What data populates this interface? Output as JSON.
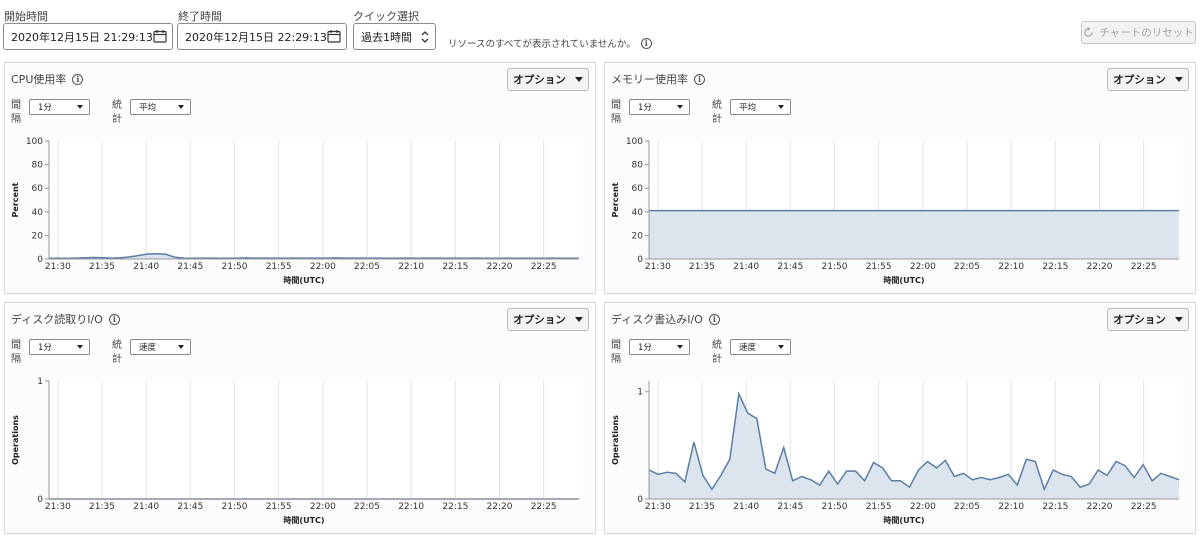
{
  "toolbar": {
    "start_label": "開始時間",
    "start_value": "2020年12月15日 21:29:13",
    "end_label": "終了時間",
    "end_value": "2020年12月15日 22:29:13",
    "quick_label": "クイック選択",
    "quick_value": "過去1時間",
    "hint": "リソースのすべてが表示されていませんか。",
    "reset_label": "チャートのリセット"
  },
  "panels": [
    {
      "title": "CPU使用率",
      "options_label": "オプション",
      "interval_label": "間隔",
      "interval_value": "1分",
      "stat_label": "統計",
      "stat_value": "平均"
    },
    {
      "title": "メモリー使用率",
      "options_label": "オプション",
      "interval_label": "間隔",
      "interval_value": "1分",
      "stat_label": "統計",
      "stat_value": "平均"
    },
    {
      "title": "ディスク読取りI/O",
      "options_label": "オプション",
      "interval_label": "間隔",
      "interval_value": "1分",
      "stat_label": "統計",
      "stat_value": "速度"
    },
    {
      "title": "ディスク書込みI/O",
      "options_label": "オプション",
      "interval_label": "間隔",
      "interval_value": "1分",
      "stat_label": "統計",
      "stat_value": "速度"
    }
  ],
  "chart_data": [
    {
      "type": "area",
      "ylabel": "Percent",
      "xlabel": "時間(UTC)",
      "ylim": [
        0,
        100
      ],
      "yticks": [
        0,
        20,
        40,
        60,
        80,
        100
      ],
      "xticks": [
        "21:30",
        "21:35",
        "21:40",
        "21:45",
        "21:50",
        "21:55",
        "22:00",
        "22:05",
        "22:10",
        "22:15",
        "22:20",
        "22:25"
      ],
      "x_start_min": 29,
      "x_end_min": 89,
      "grid": "vertical",
      "series": [
        {
          "values": [
            0.6,
            0.7,
            0.7,
            0.8,
            1.0,
            1.3,
            1.0,
            0.8,
            1.0,
            1.8,
            3.0,
            4.2,
            4.5,
            4.0,
            1.5,
            0.8,
            0.7,
            0.8,
            0.8,
            0.7,
            0.7,
            0.8,
            0.9,
            0.8,
            0.8,
            0.8,
            0.8,
            0.8,
            0.8,
            0.8,
            0.8,
            0.8,
            0.9,
            0.8,
            0.8,
            0.8,
            0.8,
            0.8,
            0.7,
            0.8,
            0.8,
            0.7,
            0.8,
            0.8,
            0.7,
            0.8,
            0.7,
            0.8,
            0.8,
            0.7,
            0.7,
            0.8,
            0.7,
            0.8,
            0.7,
            0.7,
            0.8,
            0.7,
            0.7,
            0.7
          ]
        }
      ]
    },
    {
      "type": "area",
      "ylabel": "Percent",
      "xlabel": "時間(UTC)",
      "ylim": [
        0,
        100
      ],
      "yticks": [
        0,
        20,
        40,
        60,
        80,
        100
      ],
      "xticks": [
        "21:30",
        "21:35",
        "21:40",
        "21:45",
        "21:50",
        "21:55",
        "22:00",
        "22:05",
        "22:10",
        "22:15",
        "22:20",
        "22:25"
      ],
      "x_start_min": 29,
      "x_end_min": 89,
      "grid": "vertical",
      "series": [
        {
          "values": [
            41,
            41,
            41,
            41,
            41,
            41,
            41,
            41,
            41,
            41,
            41,
            41,
            41,
            41,
            41,
            41,
            41,
            41,
            41,
            41,
            41,
            41,
            41,
            41,
            41,
            41,
            41,
            41,
            41,
            41,
            41,
            41,
            41,
            41,
            41,
            41,
            41,
            41,
            41,
            41,
            41,
            41,
            41,
            41,
            41,
            41,
            41,
            41,
            41,
            41,
            41,
            41,
            41,
            41,
            41,
            41,
            41,
            41,
            41,
            41
          ]
        }
      ]
    },
    {
      "type": "area",
      "ylabel": "Operations",
      "xlabel": "時間(UTC)",
      "ylim": [
        0,
        1
      ],
      "yticks": [
        0,
        1
      ],
      "xticks": [
        "21:30",
        "21:35",
        "21:40",
        "21:45",
        "21:50",
        "21:55",
        "22:00",
        "22:05",
        "22:10",
        "22:15",
        "22:20",
        "22:25"
      ],
      "x_start_min": 29,
      "x_end_min": 89,
      "grid": "vertical",
      "series": [
        {
          "values": [
            0,
            0,
            0,
            0,
            0,
            0,
            0,
            0,
            0,
            0,
            0,
            0,
            0,
            0,
            0,
            0,
            0,
            0,
            0,
            0,
            0,
            0,
            0,
            0,
            0,
            0,
            0,
            0,
            0,
            0,
            0,
            0,
            0,
            0,
            0,
            0,
            0,
            0,
            0,
            0,
            0,
            0,
            0,
            0,
            0,
            0,
            0,
            0,
            0,
            0,
            0,
            0,
            0,
            0,
            0,
            0,
            0,
            0,
            0,
            0
          ]
        }
      ]
    },
    {
      "type": "area",
      "ylabel": "Operations",
      "xlabel": "時間(UTC)",
      "ylim": [
        0,
        1.1
      ],
      "yticks": [
        0,
        1
      ],
      "xticks": [
        "21:30",
        "21:35",
        "21:40",
        "21:45",
        "21:50",
        "21:55",
        "22:00",
        "22:05",
        "22:10",
        "22:15",
        "22:20",
        "22:25"
      ],
      "x_start_min": 29,
      "x_end_min": 89,
      "grid": "vertical",
      "series": [
        {
          "values": [
            0.27,
            0.23,
            0.25,
            0.24,
            0.16,
            0.53,
            0.22,
            0.09,
            0.22,
            0.37,
            0.98,
            0.8,
            0.75,
            0.28,
            0.24,
            0.48,
            0.17,
            0.21,
            0.18,
            0.13,
            0.26,
            0.14,
            0.26,
            0.26,
            0.17,
            0.34,
            0.29,
            0.17,
            0.17,
            0.11,
            0.27,
            0.35,
            0.29,
            0.36,
            0.21,
            0.24,
            0.18,
            0.2,
            0.18,
            0.2,
            0.23,
            0.13,
            0.37,
            0.35,
            0.09,
            0.27,
            0.23,
            0.21,
            0.11,
            0.14,
            0.27,
            0.22,
            0.35,
            0.31,
            0.2,
            0.32,
            0.17,
            0.24,
            0.21,
            0.18
          ]
        }
      ]
    }
  ]
}
